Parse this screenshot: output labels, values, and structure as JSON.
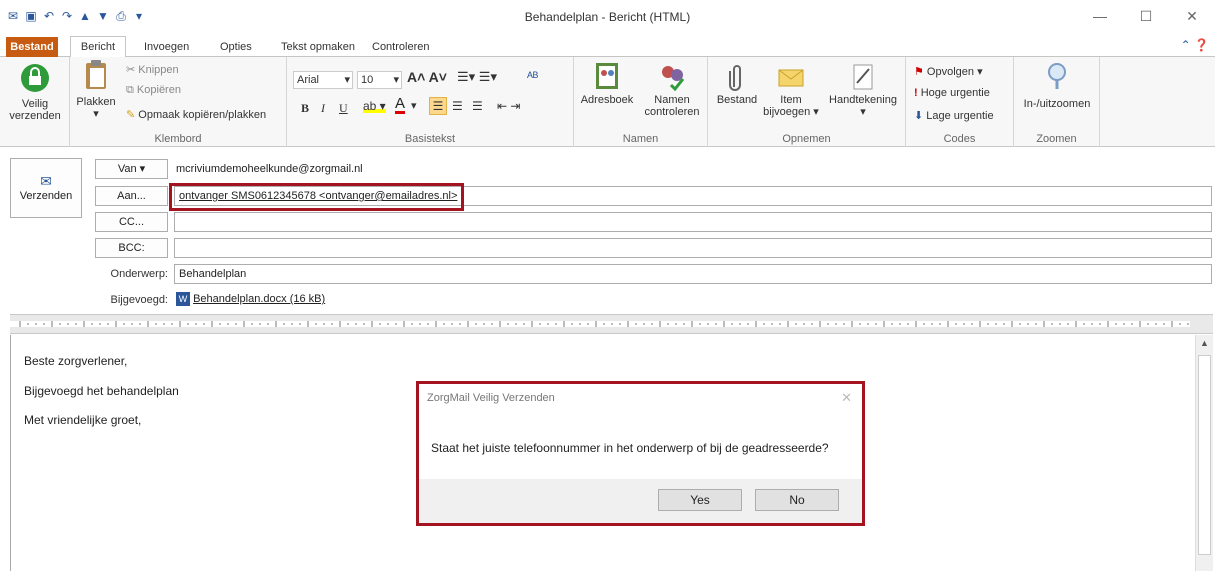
{
  "window": {
    "title": "Behandelplan  -  Bericht (HTML)"
  },
  "tabs": [
    {
      "label": "Bestand"
    },
    {
      "label": "Bericht"
    },
    {
      "label": "Invoegen"
    },
    {
      "label": "Opties"
    },
    {
      "label": "Tekst opmaken"
    },
    {
      "label": "Controleren"
    }
  ],
  "ribbon": {
    "veilig": {
      "label1": "Veilig",
      "label2": "verzenden"
    },
    "klembord": {
      "label": "Klembord",
      "plakken": "Plakken",
      "knippen": "Knippen",
      "kopieren": "Kopiëren",
      "opmaak": "Opmaak kopiëren/plakken"
    },
    "basistekst": {
      "label": "Basistekst",
      "font": "Arial",
      "size": "10",
      "bold": "B",
      "italic": "I",
      "underline": "U"
    },
    "namen": {
      "label": "Namen",
      "adresboek": "Adresboek",
      "controleren1": "Namen",
      "controleren2": "controleren"
    },
    "opnemen": {
      "label": "Opnemen",
      "bestand": "Bestand",
      "item1": "Item",
      "item2": "bijvoegen",
      "handtekening": "Handtekening"
    },
    "codes": {
      "label": "Codes",
      "opvolgen": "Opvolgen",
      "hoog": "Hoge urgentie",
      "laag": "Lage urgentie"
    },
    "zoomen": {
      "label": "Zoomen",
      "btn": "In-/uitzoomen"
    }
  },
  "compose": {
    "send": "Verzenden",
    "van_btn": "Van",
    "van_value": "mcriviumdemoheelkunde@zorgmail.nl",
    "aan_btn": "Aan...",
    "aan_value": "ontvanger SMS0612345678 <ontvanger@emailadres.nl>",
    "cc_btn": "CC...",
    "bcc_btn": "BCC:",
    "onderwerp_label": "Onderwerp:",
    "onderwerp_value": "Behandelplan",
    "bijgevoegd_label": "Bijgevoegd:",
    "bijgevoegd_value": "Behandelplan.docx (16 kB)"
  },
  "body": {
    "line1": "Beste zorgverlener,",
    "line2": "Bijgevoegd het behandelplan",
    "line3": "Met vriendelijke groet,"
  },
  "dialog": {
    "title": "ZorgMail Veilig Verzenden",
    "message": "Staat het juiste telefoonnummer in het onderwerp of bij de geadresseerde?",
    "yes": "Yes",
    "no": "No"
  }
}
